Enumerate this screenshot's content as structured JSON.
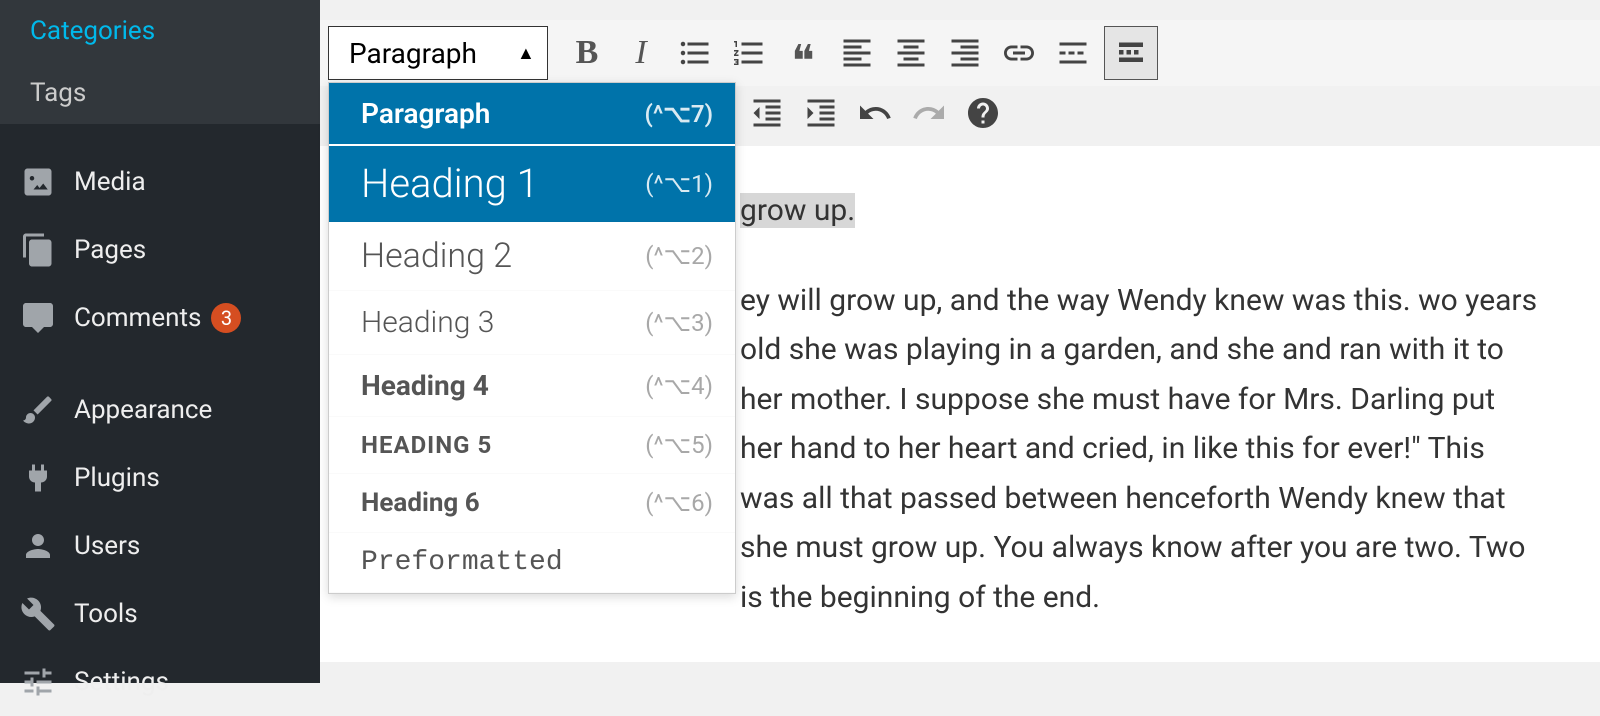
{
  "sidebar": {
    "sub_items": [
      {
        "label": "Categories"
      },
      {
        "label": "Tags"
      }
    ],
    "items": [
      {
        "label": "Media",
        "icon": "media-icon"
      },
      {
        "label": "Pages",
        "icon": "pages-icon"
      },
      {
        "label": "Comments",
        "icon": "comments-icon",
        "badge": "3"
      },
      {
        "label": "Appearance",
        "icon": "appearance-icon"
      },
      {
        "label": "Plugins",
        "icon": "plugins-icon"
      },
      {
        "label": "Users",
        "icon": "users-icon"
      },
      {
        "label": "Tools",
        "icon": "tools-icon"
      },
      {
        "label": "Settings",
        "icon": "settings-icon"
      }
    ]
  },
  "toolbar": {
    "format_selected": "Paragraph"
  },
  "format_dropdown": {
    "items": [
      {
        "label": "Paragraph",
        "shortcut": "(^⌥7)",
        "cls": "para",
        "selected": true
      },
      {
        "label": "Heading 1",
        "shortcut": "(^⌥1)",
        "cls": "h1",
        "hover": true
      },
      {
        "label": "Heading 2",
        "shortcut": "(^⌥2)",
        "cls": "h2"
      },
      {
        "label": "Heading 3",
        "shortcut": "(^⌥3)",
        "cls": "h3"
      },
      {
        "label": "Heading 4",
        "shortcut": "(^⌥4)",
        "cls": "h4"
      },
      {
        "label": "HEADING 5",
        "shortcut": "(^⌥5)",
        "cls": "h5"
      },
      {
        "label": "Heading 6",
        "shortcut": "(^⌥6)",
        "cls": "h6"
      },
      {
        "label": "Preformatted",
        "shortcut": "",
        "cls": "pre"
      }
    ]
  },
  "editor": {
    "heading_visible": " grow up.",
    "body": "ey will grow up, and the way Wendy knew was this. wo years old she was playing in a garden, and she and ran with it to her mother. I suppose she must have for Mrs. Darling put her hand to her heart and cried, in like this for ever!\" This was all that passed between henceforth Wendy knew that she must grow up. You always know after you are two. Two is the beginning of the end."
  }
}
